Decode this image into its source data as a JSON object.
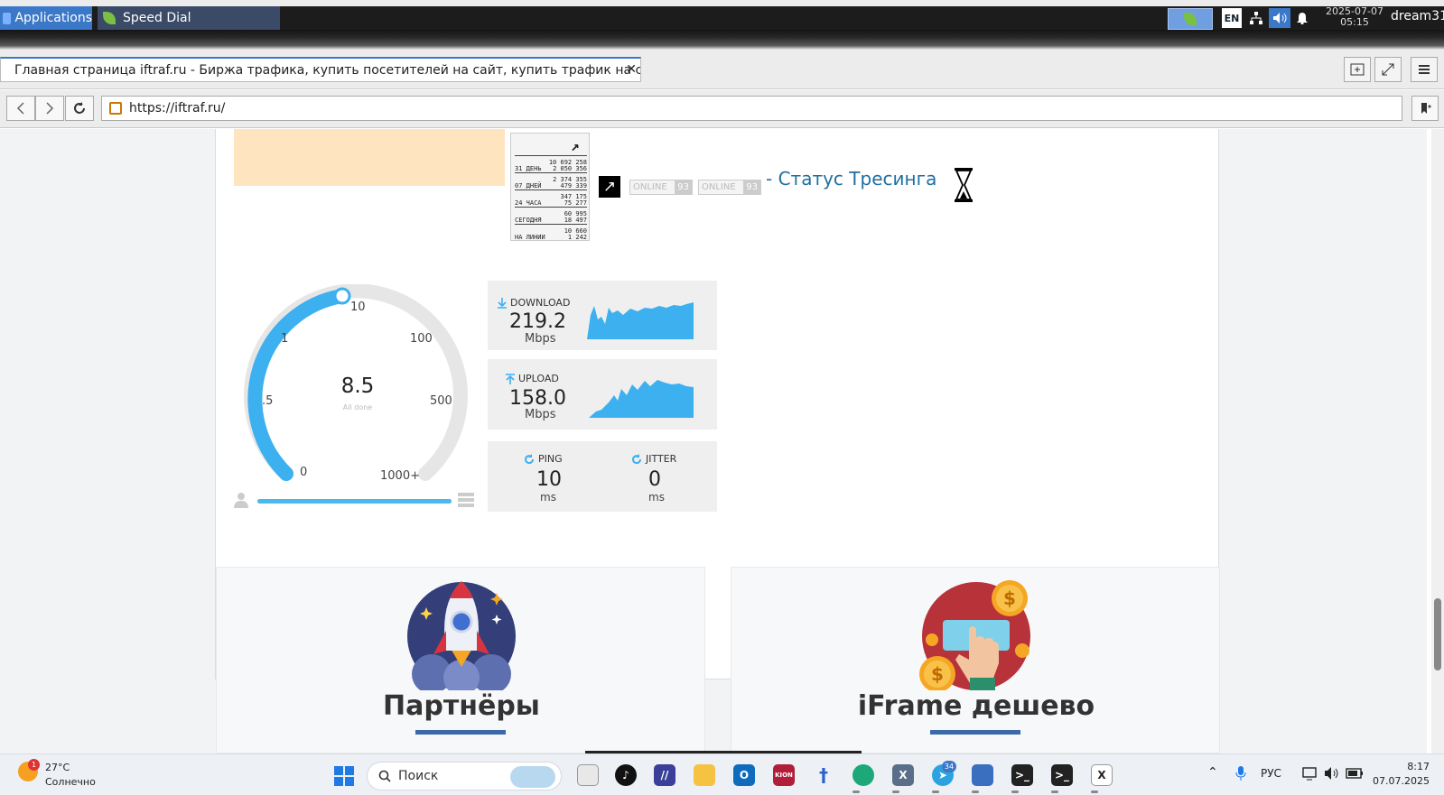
{
  "desktop_panel": {
    "applications_label": "Applications",
    "task_title": "Speed Dial",
    "keyboard_layout": "EN",
    "date": "2025-07-07",
    "time": "05:15",
    "user": "dream31"
  },
  "browser": {
    "tab_title": "Главная страница iftraf.ru - Биржа трафика, купить посетителей на сайт, купить трафик на сайт.",
    "url": "https://iftraf.ru/"
  },
  "counter_widget": {
    "rows": [
      {
        "label": "31 ДЕНЬ",
        "top": "10 692 258",
        "bottom": "2 050 356"
      },
      {
        "label": "07 ДНЕЙ",
        "top": "2 374 355",
        "bottom": "479 339"
      },
      {
        "label": "24 ЧАСА",
        "top": "347 175",
        "bottom": "75 277"
      },
      {
        "label": "СЕГОДНЯ",
        "top": "60 995",
        "bottom": "18 497"
      },
      {
        "label": "НА ЛИНИИ",
        "top": "10 660",
        "bottom": "1 242"
      }
    ]
  },
  "online_badges": [
    {
      "label": "ONLINE",
      "count": "93"
    },
    {
      "label": "ONLINE",
      "count": "93"
    }
  ],
  "trace_status_link": "- Статус Тресинга",
  "speedtest": {
    "gauge_labels": [
      "0",
      ".5",
      "1",
      "10",
      "100",
      "500",
      "1000+"
    ],
    "current_value": "8.5",
    "status": "All done",
    "progress": 1.0,
    "download": {
      "label": "DOWNLOAD",
      "value": "219.2",
      "unit": "Mbps"
    },
    "upload": {
      "label": "UPLOAD",
      "value": "158.0",
      "unit": "Mbps"
    },
    "ping": {
      "label": "PING",
      "value": "10",
      "unit": "ms"
    },
    "jitter": {
      "label": "JITTER",
      "value": "0",
      "unit": "ms"
    },
    "accent_color": "#3db0f0"
  },
  "feature_cards": [
    {
      "title": "Партнёры",
      "icon": "rocket-icon"
    },
    {
      "title": "iFrame дешево",
      "icon": "click-money-icon"
    }
  ],
  "taskbar": {
    "weather_temp": "27°C",
    "weather_desc": "Солнечно",
    "weather_alerts": "1",
    "search_placeholder": "Поиск",
    "telegram_badge": "34",
    "language": "РУС",
    "time": "8:17",
    "date": "07.07.2025"
  }
}
